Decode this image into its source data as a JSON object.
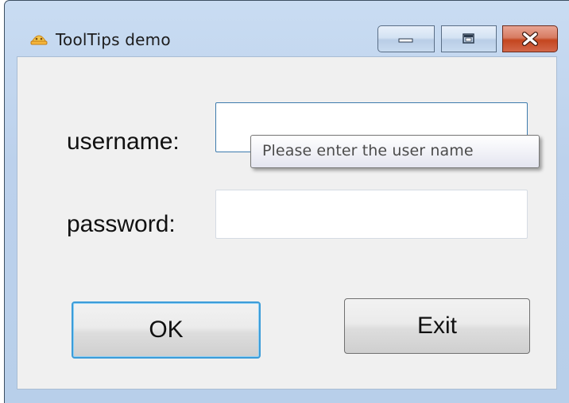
{
  "window": {
    "title": "ToolTips demo",
    "icon": "app-icon",
    "controls": {
      "minimize_icon": "minimize-icon",
      "maximize_icon": "maximize-icon",
      "close_icon": "close-icon"
    }
  },
  "form": {
    "username_label": "username:",
    "username_value": "",
    "password_label": "password:",
    "password_value": "",
    "tooltip_text": "Please enter the user name",
    "ok_label": "OK",
    "exit_label": "Exit"
  },
  "colors": {
    "focus_border": "#3c9cd8",
    "close_button": "#c4461f",
    "titlebar": "#bcd1ec"
  }
}
